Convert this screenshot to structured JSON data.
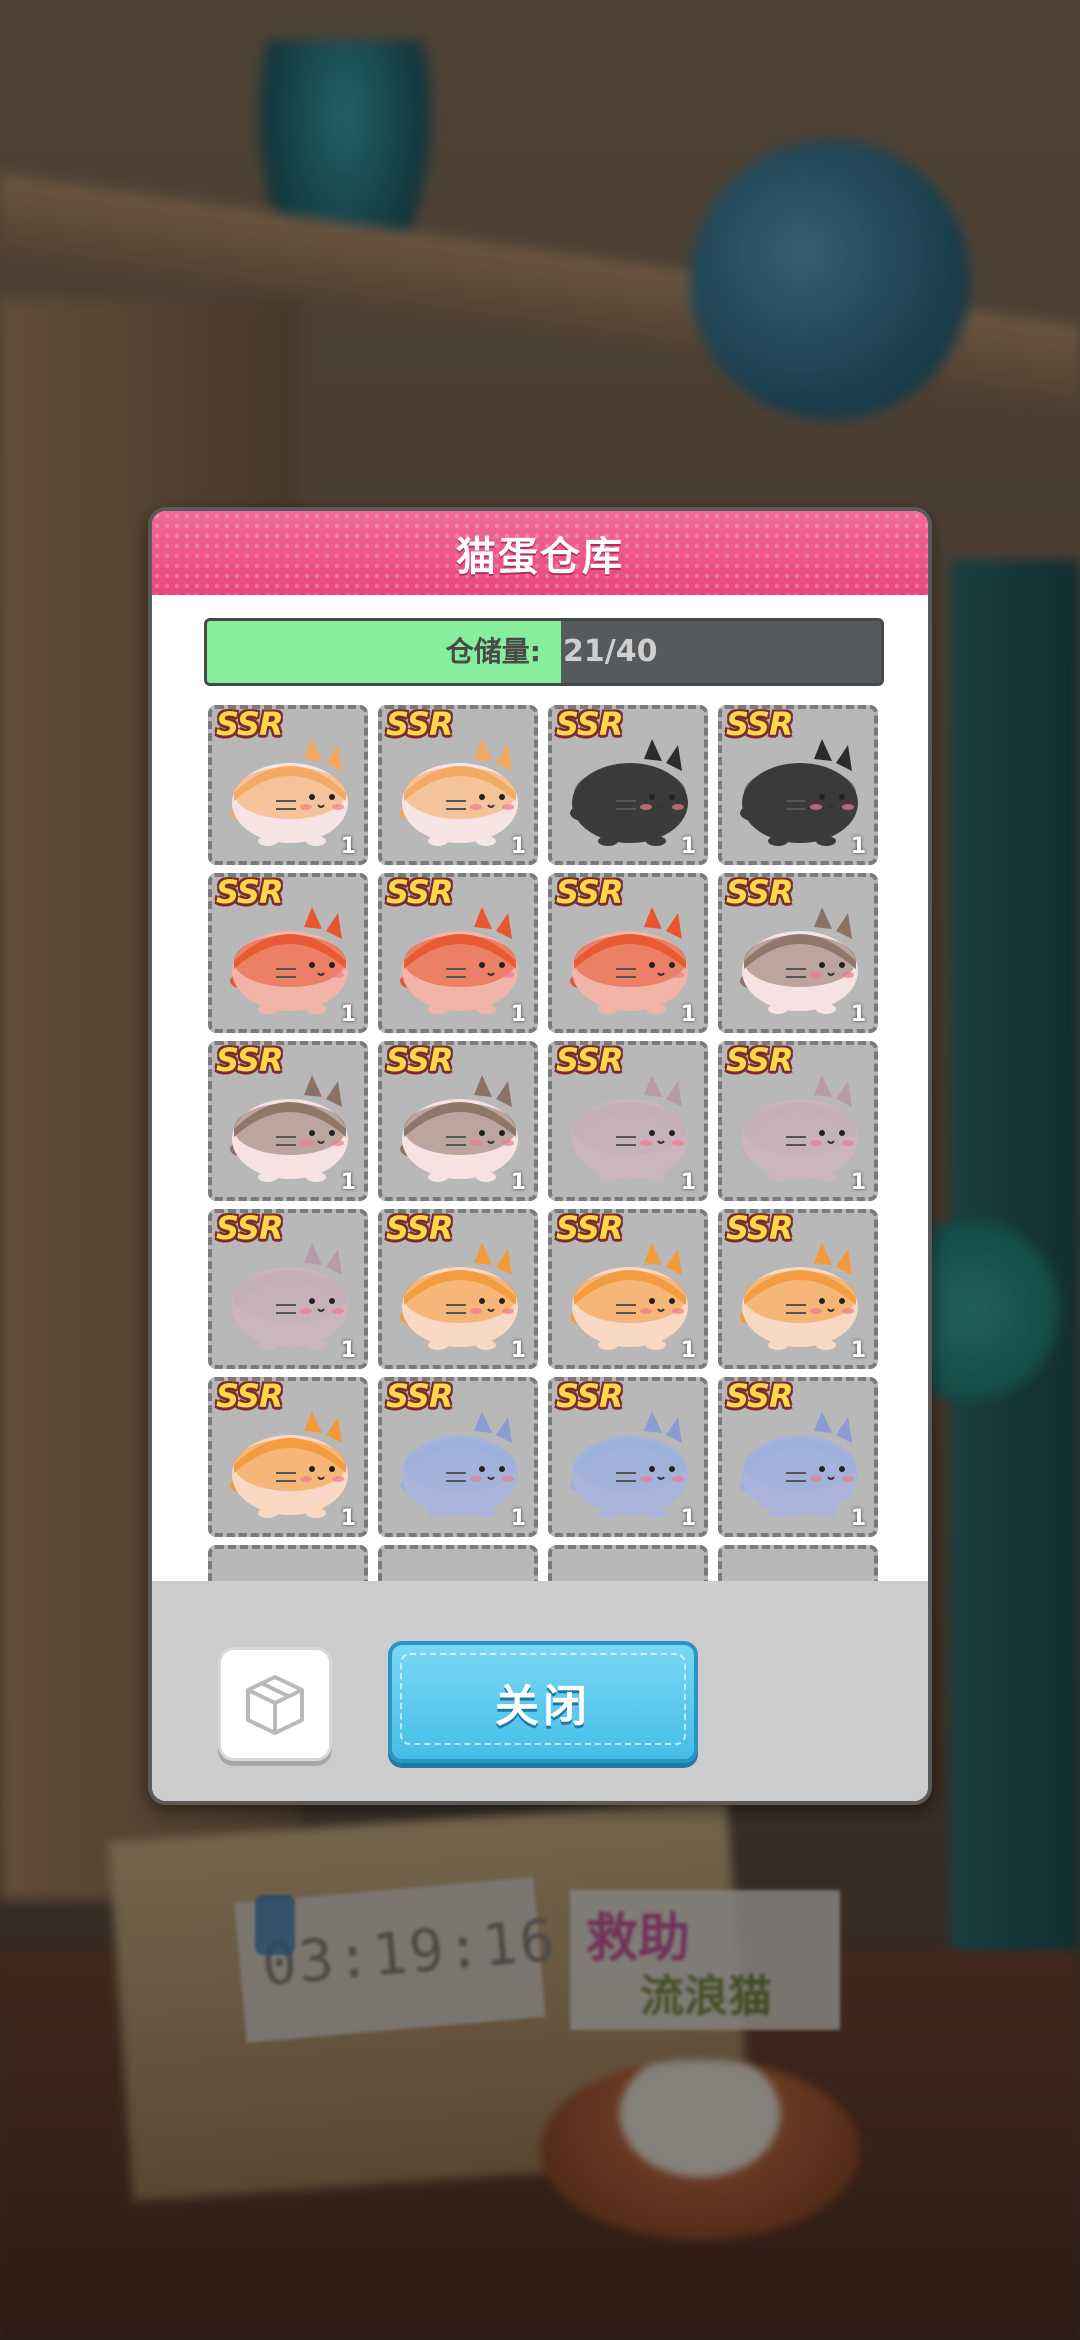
{
  "background": {
    "timer": "03:19:16",
    "sign_line1": "救助",
    "sign_line2": "流浪猫"
  },
  "dialog": {
    "title": "猫蛋仓库",
    "storage_label": "仓储量:",
    "storage_count": "21/40",
    "storage_progress": 0.525,
    "close_label": "关闭",
    "box_icon": "box-icon"
  },
  "items": [
    {
      "rarity": "SSR",
      "qty": "1",
      "cat": "calico"
    },
    {
      "rarity": "SSR",
      "qty": "1",
      "cat": "calico"
    },
    {
      "rarity": "SSR",
      "qty": "1",
      "cat": "black"
    },
    {
      "rarity": "SSR",
      "qty": "1",
      "cat": "black"
    },
    {
      "rarity": "SSR",
      "qty": "1",
      "cat": "red"
    },
    {
      "rarity": "SSR",
      "qty": "1",
      "cat": "red"
    },
    {
      "rarity": "SSR",
      "qty": "1",
      "cat": "red"
    },
    {
      "rarity": "SSR",
      "qty": "1",
      "cat": "tricolor"
    },
    {
      "rarity": "SSR",
      "qty": "1",
      "cat": "tricolor"
    },
    {
      "rarity": "SSR",
      "qty": "1",
      "cat": "tricolor"
    },
    {
      "rarity": "SSR",
      "qty": "1",
      "cat": "lilac"
    },
    {
      "rarity": "SSR",
      "qty": "1",
      "cat": "lilac"
    },
    {
      "rarity": "SSR",
      "qty": "1",
      "cat": "lilac"
    },
    {
      "rarity": "SSR",
      "qty": "1",
      "cat": "orange"
    },
    {
      "rarity": "SSR",
      "qty": "1",
      "cat": "orange"
    },
    {
      "rarity": "SSR",
      "qty": "1",
      "cat": "orange"
    },
    {
      "rarity": "SSR",
      "qty": "1",
      "cat": "orange"
    },
    {
      "rarity": "SSR",
      "qty": "1",
      "cat": "blue"
    },
    {
      "rarity": "SSR",
      "qty": "1",
      "cat": "blue"
    },
    {
      "rarity": "SSR",
      "qty": "1",
      "cat": "blue"
    }
  ],
  "colors": {
    "calico": {
      "body": "#f7e4e4",
      "head": "#f3a75c",
      "ear": "#f3a75c"
    },
    "black": {
      "body": "#3b3b3b",
      "head": "#3b3b3b",
      "ear": "#2b2b2b"
    },
    "red": {
      "body": "#f2b3a8",
      "head": "#e8552e",
      "ear": "#e8552e"
    },
    "tricolor": {
      "body": "#f6e2e2",
      "head": "#8b7265",
      "ear": "#8b7265"
    },
    "lilac": {
      "body": "#cbb6bf",
      "head": "#c4aeb8",
      "ear": "#b89aa8"
    },
    "orange": {
      "body": "#f9d8c4",
      "head": "#f29a3a",
      "ear": "#f29a3a"
    },
    "blue": {
      "body": "#aab3d9",
      "head": "#9cb0dc",
      "ear": "#8b9dd0"
    }
  }
}
